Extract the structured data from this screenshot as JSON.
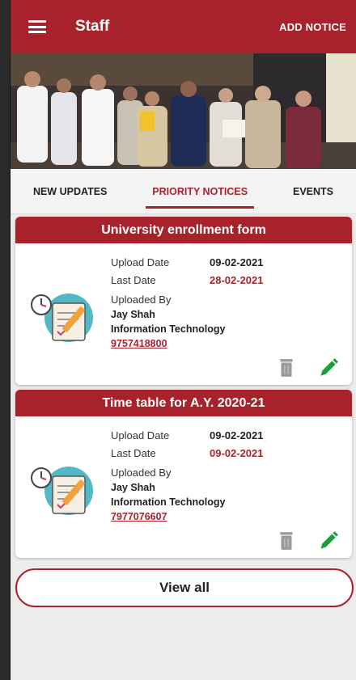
{
  "appbar": {
    "title": "Staff",
    "add_notice_label": "ADD NOTICE",
    "icons": {
      "menu": "hamburger-icon"
    }
  },
  "tabs": [
    {
      "label": "NEW UPDATES",
      "active": false
    },
    {
      "label": "PRIORITY NOTICES",
      "active": true
    },
    {
      "label": "EVENTS",
      "active": false
    }
  ],
  "notices": [
    {
      "title": "University enrollment form",
      "upload_date_label": "Upload Date",
      "upload_date": "09-02-2021",
      "last_date_label": "Last Date",
      "last_date": "28-02-2021",
      "uploaded_by_label": "Uploaded By",
      "uploader_name": "Jay Shah",
      "department": "Information Technology",
      "phone": "9757418800"
    },
    {
      "title": "Time table for A.Y. 2020-21",
      "upload_date_label": "Upload Date",
      "upload_date": "09-02-2021",
      "last_date_label": "Last Date",
      "last_date": "09-02-2021",
      "uploaded_by_label": "Uploaded By",
      "uploader_name": "Jay Shah",
      "department": "Information Technology",
      "phone": "7977076607"
    }
  ],
  "view_all_label": "View all",
  "colors": {
    "primary": "#a8222c",
    "edit": "#1e9e3a",
    "delete": "#9a9a9a"
  }
}
